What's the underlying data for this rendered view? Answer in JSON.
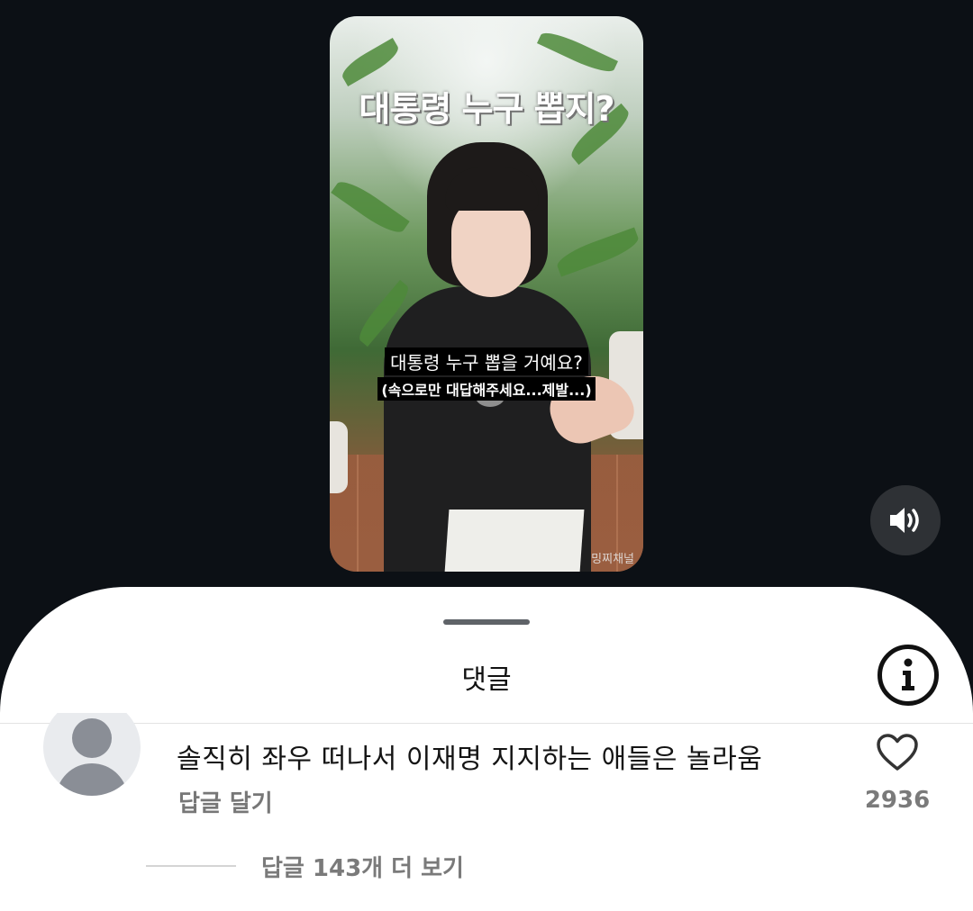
{
  "video": {
    "title_overlay": "대통령 누구 뽑지?",
    "subtitle_line1": "대통령 누구 뽑을 거예요?",
    "subtitle_line2": "(속으로만 대답해주세요...제발...)",
    "watermark": "밍찌채널"
  },
  "controls": {
    "sound_icon": "speaker-volume-icon"
  },
  "comments_sheet": {
    "title": "댓글",
    "info_icon": "info-icon",
    "comment": {
      "text": "솔직히 좌우 떠나서 이재명 지지하는 애들은 놀라움",
      "reply_label": "답글 달기",
      "like_count": "2936",
      "more_replies": "답글 143개 더 보기"
    }
  }
}
